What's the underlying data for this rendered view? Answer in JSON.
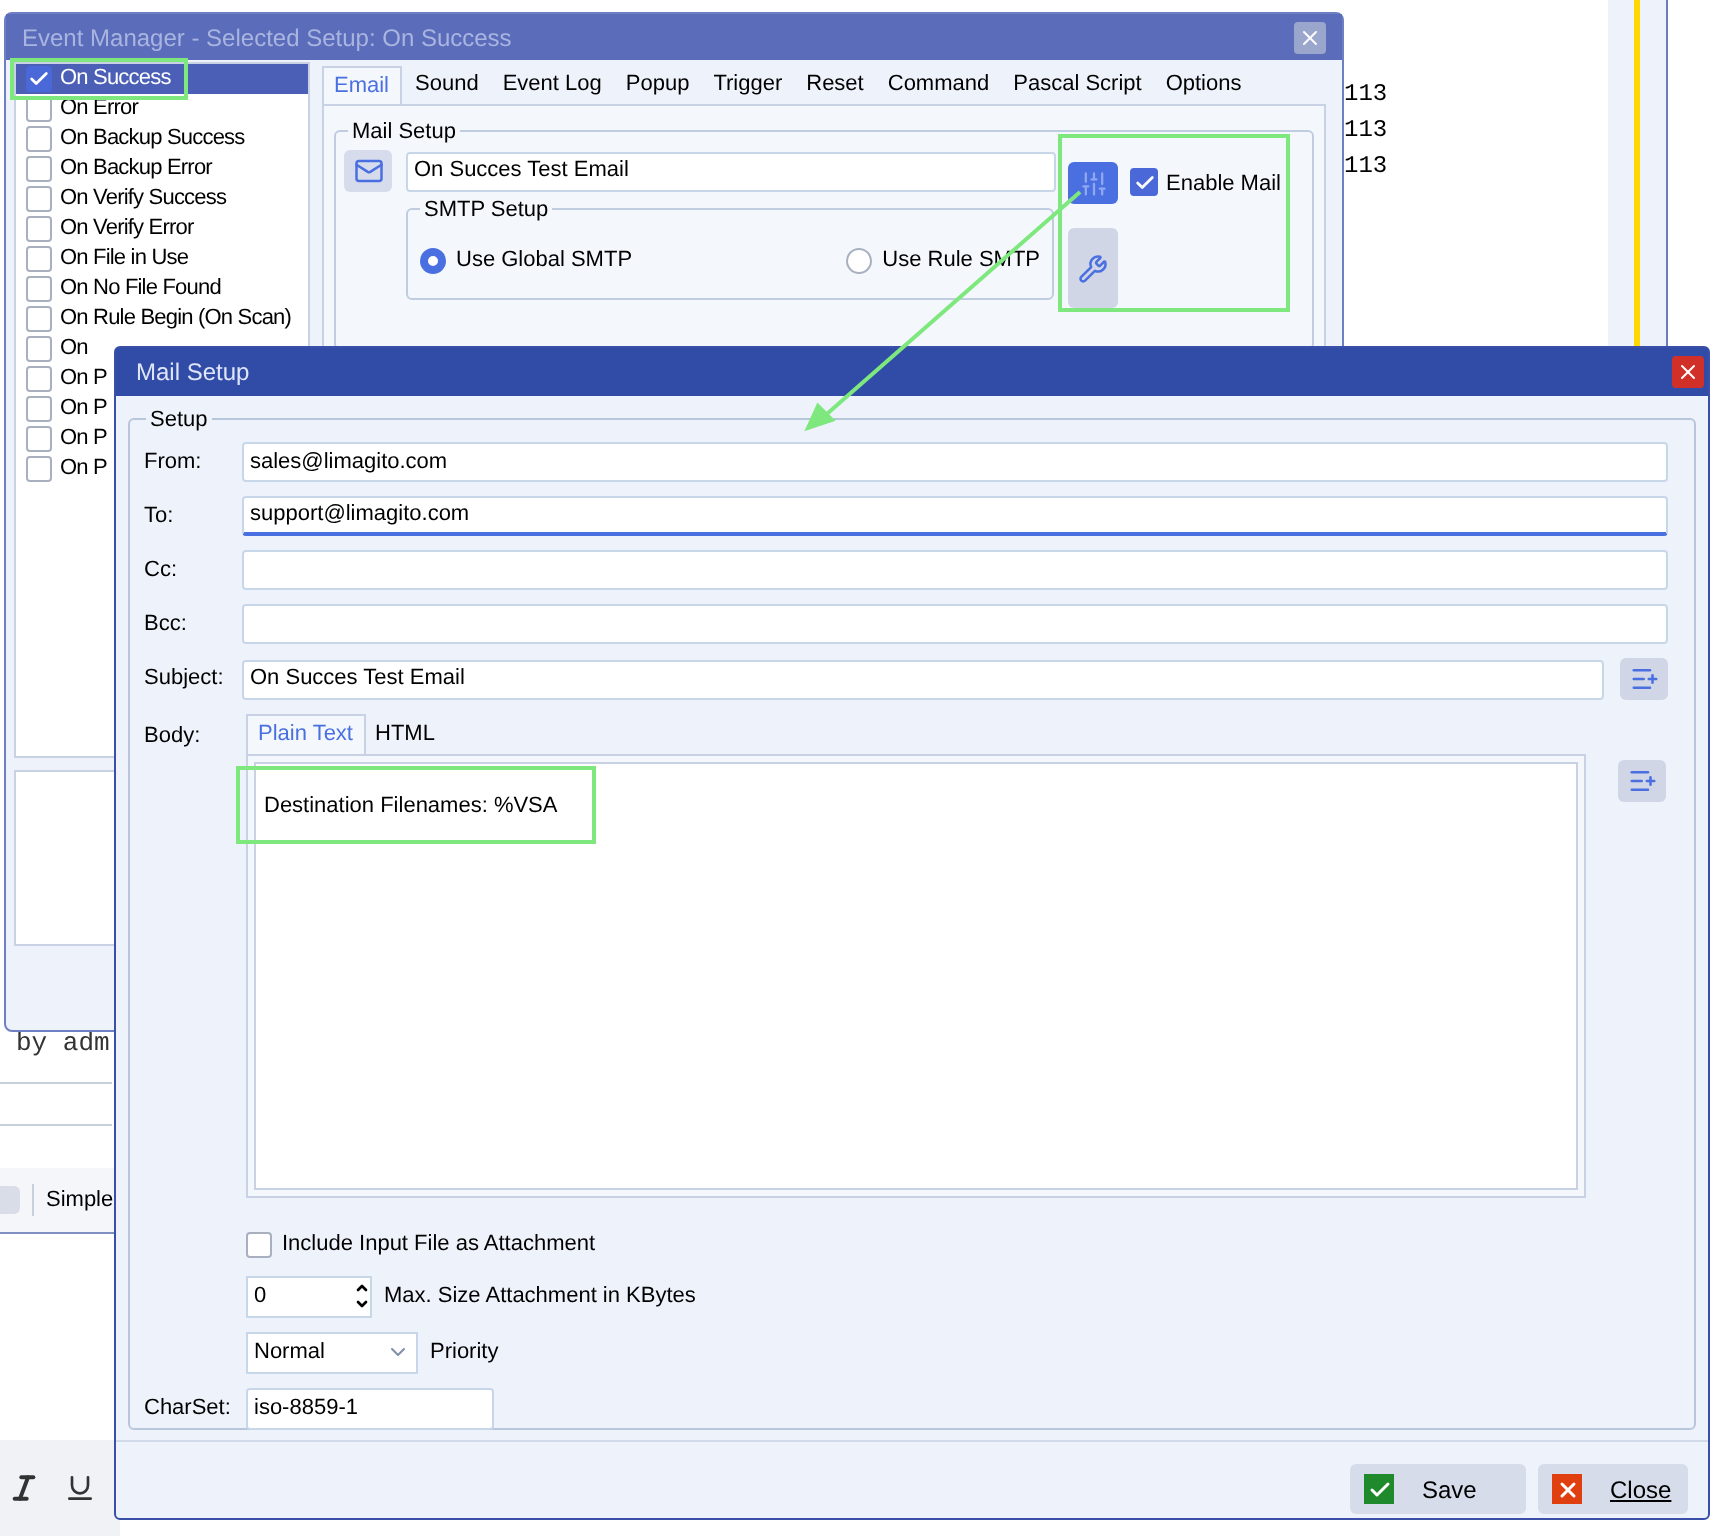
{
  "background": {
    "column_values": [
      "113",
      "113",
      "113"
    ],
    "text_fragment": "by adm",
    "toolbar_label": "Simple"
  },
  "event_manager": {
    "title": "Event Manager - Selected Setup: On Success",
    "events": [
      {
        "label": "On Success",
        "checked": true,
        "selected": true
      },
      {
        "label": "On Error",
        "checked": false,
        "selected": false
      },
      {
        "label": "On Backup Success",
        "checked": false,
        "selected": false
      },
      {
        "label": "On Backup Error",
        "checked": false,
        "selected": false
      },
      {
        "label": "On Verify Success",
        "checked": false,
        "selected": false
      },
      {
        "label": "On Verify Error",
        "checked": false,
        "selected": false
      },
      {
        "label": "On File in Use",
        "checked": false,
        "selected": false
      },
      {
        "label": "On No File Found",
        "checked": false,
        "selected": false
      },
      {
        "label": "On Rule Begin (On Scan)",
        "checked": false,
        "selected": false
      },
      {
        "label": "On",
        "checked": false,
        "selected": false
      },
      {
        "label": "On P",
        "checked": false,
        "selected": false
      },
      {
        "label": "On P",
        "checked": false,
        "selected": false
      },
      {
        "label": "On P",
        "checked": false,
        "selected": false
      },
      {
        "label": "On P",
        "checked": false,
        "selected": false
      }
    ],
    "tabs": [
      {
        "label": "Email",
        "selected": true
      },
      {
        "label": "Sound",
        "selected": false
      },
      {
        "label": "Event Log",
        "selected": false
      },
      {
        "label": "Popup",
        "selected": false
      },
      {
        "label": "Trigger",
        "selected": false
      },
      {
        "label": "Reset",
        "selected": false
      },
      {
        "label": "Command",
        "selected": false
      },
      {
        "label": "Pascal Script",
        "selected": false
      },
      {
        "label": "Options",
        "selected": false
      }
    ],
    "mail_setup": {
      "legend": "Mail Setup",
      "subject": "On Succes Test Email",
      "enable_mail": {
        "label": "Enable Mail",
        "checked": true
      },
      "smtp": {
        "legend": "SMTP Setup",
        "options": [
          {
            "label": "Use Global SMTP",
            "selected": true
          },
          {
            "label": "Use Rule SMTP",
            "selected": false
          }
        ]
      }
    }
  },
  "mail_dialog": {
    "title": "Mail Setup",
    "legend": "Setup",
    "fields": [
      {
        "label": "From:",
        "value": "sales@limagito.com",
        "focused": false
      },
      {
        "label": "To:",
        "value": "support@limagito.com",
        "focused": true
      },
      {
        "label": "Cc:",
        "focused": false
      },
      {
        "label": "Bcc:",
        "focused": false
      }
    ],
    "subject": {
      "label": "Subject:",
      "value": "On Succes Test Email"
    },
    "body": {
      "label": "Body:",
      "tabs": [
        {
          "label": "Plain Text",
          "selected": true
        },
        {
          "label": "HTML",
          "selected": false
        }
      ],
      "text": "Destination Filenames: %VSA"
    },
    "attachment": {
      "label": "Include Input File as Attachment",
      "checked": false
    },
    "max_size": {
      "value": "0",
      "label": "Max. Size Attachment in KBytes"
    },
    "priority": {
      "value": "Normal",
      "label": "Priority"
    },
    "charset": {
      "label": "CharSet:",
      "value": "iso-8859-1"
    },
    "buttons": [
      {
        "label": "Save",
        "kind": "save"
      },
      {
        "label": "Close",
        "kind": "close"
      }
    ]
  }
}
